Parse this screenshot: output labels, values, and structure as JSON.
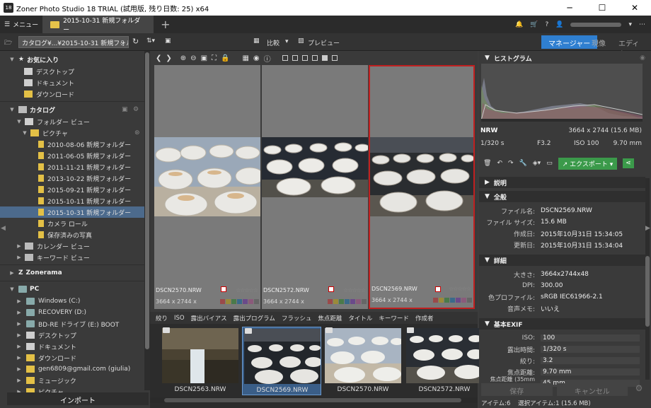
{
  "window": {
    "title": "Zoner Photo Studio 18 TRIAL (試用版, 残り日数: 25) x64",
    "app_icon": "18"
  },
  "tabbar": {
    "menu_label": "メニュー",
    "tab_label": "2015-10-31 新規フォルダー"
  },
  "toolbar": {
    "path": "カタログ¥...¥2015-10-31 新規フォルダー",
    "compare_label": "比較",
    "preview_label": "プレビュー",
    "modes": [
      "マネージャー",
      "現像",
      "エディター"
    ]
  },
  "sidebar": {
    "favorites_header": "お気に入り",
    "favorites": [
      "デスクトップ",
      "ドキュメント",
      "ダウンロード"
    ],
    "catalog_header": "カタログ",
    "folder_view": "フォルダー ビュー",
    "pictures": "ピクチャ",
    "folders": [
      "2010-08-06 新規フォルダー",
      "2011-06-05 新規フォルダー",
      "2011-11-21 新規フォルダー",
      "2013-10-22 新規フォルダー",
      "2015-09-21 新規フォルダー",
      "2015-10-11 新規フォルダー",
      "2015-10-31 新規フォルダー"
    ],
    "camera_roll": "カメラ ロール",
    "saved_photos": "保存済みの写真",
    "calendar_view": "カレンダー ビュー",
    "keyword_view": "キーワード ビュー",
    "zonerama": "Zonerama",
    "pc_header": "PC",
    "drives": [
      "Windows (C:)",
      "RECOVERY (D:)",
      "BD-RE ドライブ (E:) BOOT",
      "デスクトップ",
      "ドキュメント",
      "ダウンロード",
      "gen6809@gmail.com (giulia)",
      "ミュージック",
      "ピクチャ"
    ],
    "import_label": "インポート"
  },
  "compare": {
    "cells": [
      {
        "name": "DSCN2570.NRW",
        "dims": "3664 x 2744 x"
      },
      {
        "name": "DSCN2572.NRW",
        "dims": "3664 x 2744 x"
      },
      {
        "name": "DSCN2569.NRW",
        "dims": "3664 x 2744 x"
      }
    ]
  },
  "filterbar": [
    "絞り",
    "ISO",
    "露出バイアス",
    "露出プログラム",
    "フラッシュ",
    "焦点距離",
    "タイトル",
    "キーワード",
    "作成者"
  ],
  "filmstrip": [
    "DSCN2563.NRW",
    "DSCN2569.NRW",
    "DSCN2570.NRW",
    "DSCN2572.NRW"
  ],
  "right": {
    "histogram_label": "ヒストグラム",
    "format": "NRW",
    "size_info": "3664 x 2744 (15.6 MB)",
    "shutter": "1/320 s",
    "aperture": "F3.2",
    "iso": "ISO 100",
    "focal": "9.70 mm",
    "export_label": "エクスポート",
    "desc_header": "説明",
    "general_header": "全般",
    "general": [
      {
        "k": "ファイル名:",
        "v": "DSCN2569.NRW"
      },
      {
        "k": "ファイル サイズ:",
        "v": "15.6 MB"
      },
      {
        "k": "作成日:",
        "v": "2015年10月31日 15:34:05"
      },
      {
        "k": "更新日:",
        "v": "2015年10月31日 15:34:04"
      }
    ],
    "detail_header": "詳細",
    "detail": [
      {
        "k": "大きさ:",
        "v": "3664x2744x48"
      },
      {
        "k": "DPI:",
        "v": "300.00"
      },
      {
        "k": "色プロファイル:",
        "v": "sRGB IEC61966-2.1"
      },
      {
        "k": "音声メモ:",
        "v": "いいえ"
      }
    ],
    "exif_header": "基本EXIF",
    "exif": [
      {
        "k": "ISO:",
        "v": "100"
      },
      {
        "k": "露出時間:",
        "v": "1/320 s"
      },
      {
        "k": "絞り:",
        "v": "3.2"
      },
      {
        "k": "焦点距離:",
        "v": "9.70 mm"
      },
      {
        "k": "焦点距離 (35mm換...",
        "v": "45 mm"
      }
    ],
    "save_label": "保存",
    "cancel_label": "キャンセル",
    "status_items": "アイテム:6",
    "status_selected": "選択アイテム:1 (15.6 MB)"
  },
  "colors": {
    "accent": "#2f7fd0",
    "selection": "#c02020",
    "export": "#3b9a4a",
    "folder": "#e3c046"
  }
}
